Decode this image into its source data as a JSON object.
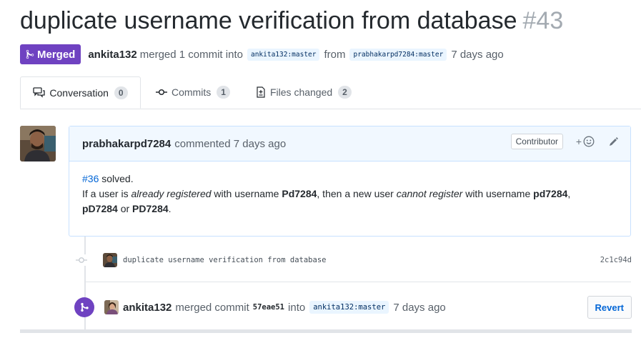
{
  "pr": {
    "title": "duplicate username verification from database",
    "number": "#43",
    "state": "Merged",
    "merged_by": "ankita132",
    "merge_text": "merged 1 commit into",
    "base_branch": "ankita132:master",
    "from_word": "from",
    "head_branch": "prabhakarpd7284:master",
    "time_ago": "7 days ago"
  },
  "tabs": [
    {
      "label": "Conversation",
      "count": "0",
      "icon": "comment-discussion-icon"
    },
    {
      "label": "Commits",
      "count": "1",
      "icon": "git-commit-icon"
    },
    {
      "label": "Files changed",
      "count": "2",
      "icon": "file-diff-icon"
    }
  ],
  "comment": {
    "author": "prabhakarpd7284",
    "action": "commented 7 days ago",
    "role_badge": "Contributor",
    "reaction_label": "+",
    "body": {
      "issue_ref": "#36",
      "line1_rest": " solved.",
      "l2_a": "If a user is ",
      "l2_b": "already registered",
      "l2_c": " with username ",
      "l2_d": "Pd7284",
      "l2_e": ", then a new user ",
      "l2_f": "cannot register",
      "l2_g": " with username ",
      "l2_h": "pd7284",
      "l2_i": ",",
      "l3_a": "pD7284",
      "l3_b": " or ",
      "l3_c": "PD7284",
      "l3_d": "."
    }
  },
  "commit": {
    "message": "duplicate username verification from database",
    "sha": "2c1c94d"
  },
  "merge_event": {
    "author": "ankita132",
    "text": "merged commit",
    "sha": "57eae51",
    "into": "into",
    "branch": "ankita132:master",
    "time_ago": "7 days ago",
    "revert_label": "Revert"
  },
  "colors": {
    "merged_purple": "#6f42c1",
    "link_blue": "#0366d6",
    "comment_header_bg": "#f1f8ff"
  }
}
